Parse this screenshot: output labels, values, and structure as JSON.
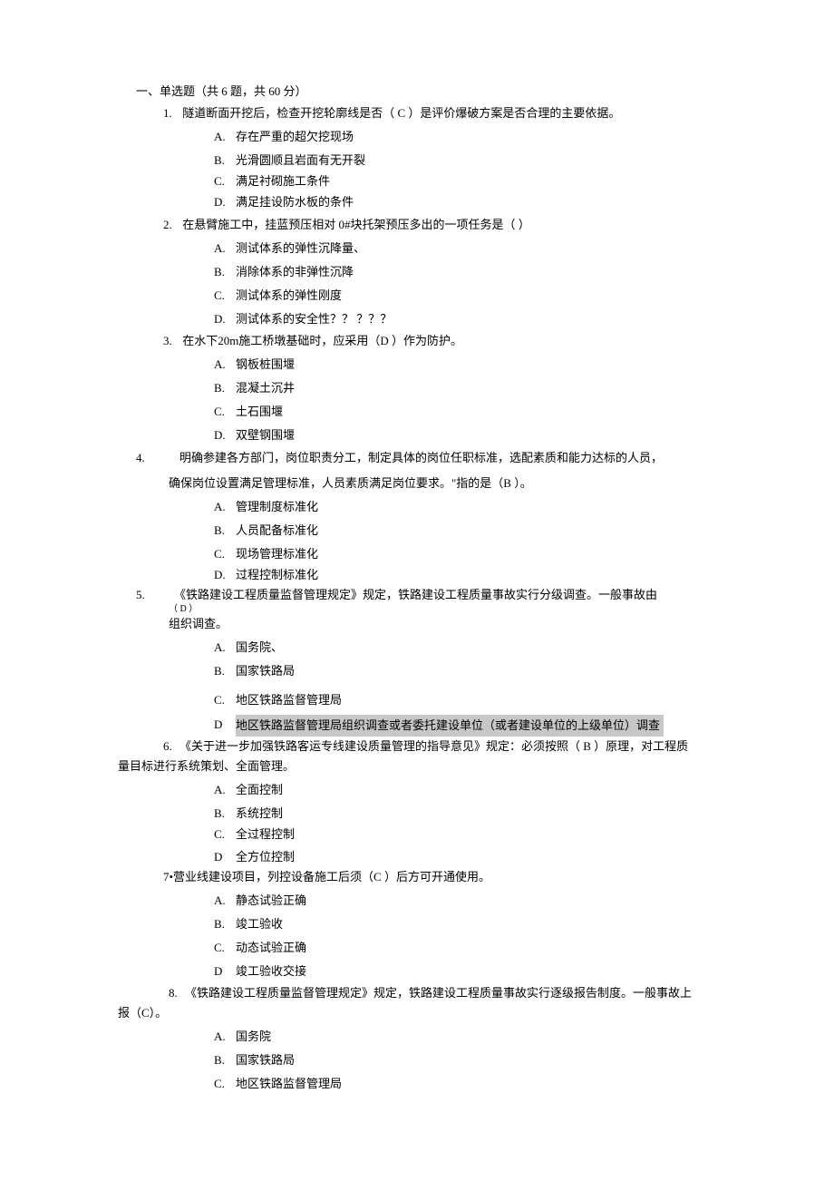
{
  "section_header": "一、单选题（共 6 题，共 60 分）",
  "questions": [
    {
      "num": "1.",
      "text": "隧道断面开挖后，检查开挖轮廓线是否（ C ）是评价爆破方案是否合理的主要依据。",
      "options": [
        {
          "letter": "A.",
          "text": "存在严重的超欠挖现场"
        },
        {
          "letter": "B.",
          "text": "光滑圆顺且岩面有无开裂"
        },
        {
          "letter": "C.",
          "text": "满足衬砌施工条件"
        },
        {
          "letter": "D.",
          "text": "满足挂设防水板的条件"
        }
      ]
    },
    {
      "num": "2.",
      "text": "在悬臂施工中，挂蓝预压相对 0#块托架预压多出的一项任务是（ ）",
      "options": [
        {
          "letter": "A.",
          "text": "测试体系的弹性沉降量、"
        },
        {
          "letter": "B.",
          "text": "消除体系的非弹性沉降"
        },
        {
          "letter": "C.",
          "text": "测试体系的弹性刚度"
        },
        {
          "letter": "D.",
          "text": "测试体系的安全性？？ ？？？"
        }
      ]
    },
    {
      "num": "3.",
      "text": "在水下20m施工桥墩基础时，应采用（D ）作为防护。",
      "options": [
        {
          "letter": "A.",
          "text": "钢板桩围堰"
        },
        {
          "letter": "B.",
          "text": "混凝土沉井"
        },
        {
          "letter": "C.",
          "text": "土石围堰"
        },
        {
          "letter": "D.",
          "text": "双壁钢围堰"
        }
      ]
    },
    {
      "num": "4.",
      "text": "明确参建各方部门，岗位职责分工，制定具体的岗位任职标准，选配素质和能力达标的人员，",
      "text_cont": "确保岗位设置满足管理标准，人员素质满足岗位要求。\"指的是（B ）。",
      "options": [
        {
          "letter": "A.",
          "text": "管理制度标准化"
        },
        {
          "letter": "B.",
          "text": "人员配备标准化"
        },
        {
          "letter": "C.",
          "text": "现场管理标准化"
        },
        {
          "letter": "D.",
          "text": "过程控制标准化"
        }
      ]
    }
  ],
  "q5": {
    "num": "5.",
    "line1": "《铁路建设工程质量监督管理规定》规定，铁路建设工程质量事故实行分级调查。一般事故由",
    "sub": "（ D ）",
    "line2": "组织调查。",
    "options": [
      {
        "letter": "A.",
        "text": "国务院、"
      },
      {
        "letter": "B.",
        "text": "国家铁路局"
      },
      {
        "letter": "C.",
        "text": "地区铁路监督管理局"
      }
    ],
    "optD_letter": "D",
    "optD_text": "地区铁路监督管理局组织调查或者委托建设单位（或者建设单位的上级单位）调查"
  },
  "q6": {
    "num": "6.",
    "line1": "《关于进一步加强铁路客运专线建设质量管理的指导意见》规定：必须按照（ B ）原理，对工程质",
    "line2": "量目标进行系统策划、全面管理。",
    "options": [
      {
        "letter": "A.",
        "text": "全面控制"
      },
      {
        "letter": "B.",
        "text": "系统控制"
      },
      {
        "letter": "C.",
        "text": "全过程控制"
      }
    ],
    "optD_letter": "D",
    "optD_text": "全方位控制"
  },
  "q7": {
    "line": "7•营业线建设项目，列控设备施工后须（C ）后方可开通使用。",
    "options": [
      {
        "letter": "A.",
        "text": "静态试验正确"
      },
      {
        "letter": "B.",
        "text": "竣工验收"
      },
      {
        "letter": "C.",
        "text": "动态试验正确"
      }
    ],
    "optD_letter": "D",
    "optD_text": "竣工验收交接"
  },
  "q8": {
    "num": "8.",
    "line1": "《铁路建设工程质量监督管理规定》规定，铁路建设工程质量事故实行逐级报告制度。一般事故上",
    "line2": "报（C）。",
    "options": [
      {
        "letter": "A.",
        "text": "国务院"
      },
      {
        "letter": "B.",
        "text": "国家铁路局"
      },
      {
        "letter": "C.",
        "text": "地区铁路监督管理局"
      }
    ]
  }
}
